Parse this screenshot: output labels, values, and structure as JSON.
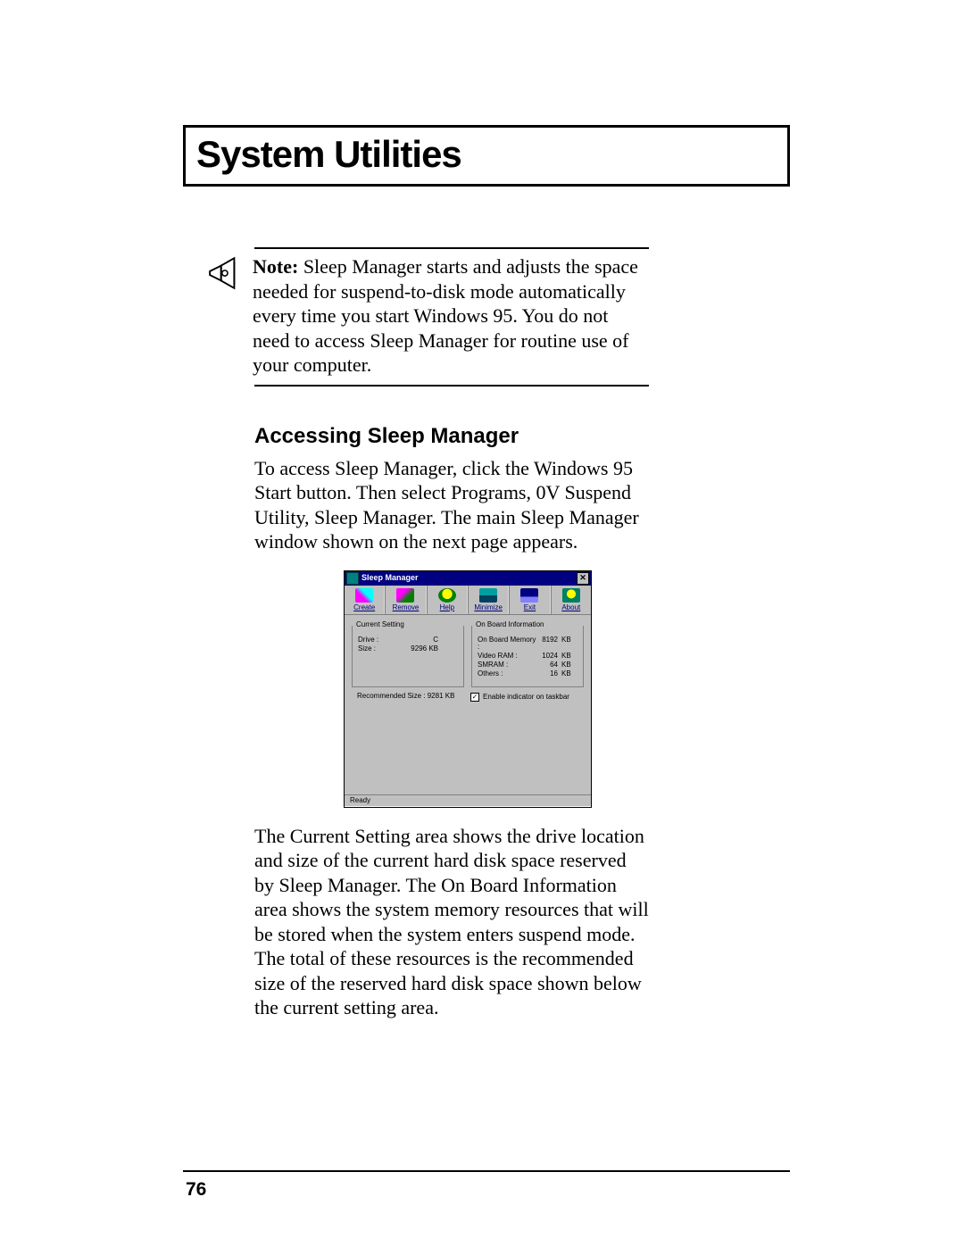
{
  "chapter_title": "System Utilities",
  "note": {
    "label": "Note:",
    "text": "Sleep Manager starts and adjusts the space needed for suspend-to-disk mode automatically every time you start Windows 95. You do not need to access Sleep Manager for routine use of your computer."
  },
  "section_heading": "Accessing Sleep Manager",
  "para_before": "To access Sleep Manager, click the Windows 95 Start button. Then select Programs, 0V Suspend Utility, Sleep Manager. The main Sleep Manager window shown on the next page appears.",
  "sm": {
    "title": "Sleep Manager",
    "toolbar": {
      "create": {
        "label": "Create"
      },
      "remove": {
        "label": "Remove"
      },
      "help": {
        "label": "Help"
      },
      "minimize": {
        "label": "Minimize"
      },
      "exit": {
        "label": "Exit"
      },
      "about": {
        "label": "About"
      }
    },
    "current_setting": {
      "legend": "Current Setting",
      "drive_label": "Drive :",
      "drive_value": "C",
      "size_label": "Size :",
      "size_value": "9296 KB"
    },
    "onboard": {
      "legend": "On Board Information",
      "rows": [
        {
          "label": "On Board Memory :",
          "value": "8192",
          "unit": "KB"
        },
        {
          "label": "Video RAM :",
          "value": "1024",
          "unit": "KB"
        },
        {
          "label": "SMRAM :",
          "value": "64",
          "unit": "KB"
        },
        {
          "label": "Others :",
          "value": "16",
          "unit": "KB"
        }
      ]
    },
    "recommended_label": "Recommended Size :",
    "recommended_value": "9281 KB",
    "enable_indicator_label": "Enable indicator on taskbar",
    "enable_indicator_checked": true,
    "status": "Ready"
  },
  "para_after": "The Current Setting area shows the drive location and size of the current hard disk space reserved by Sleep Manager. The On Board Information area shows the system memory resources that will be stored when the system enters suspend mode. The total of these resources is the recommended size of the reserved hard disk space shown below the current setting area.",
  "page_number": "76"
}
